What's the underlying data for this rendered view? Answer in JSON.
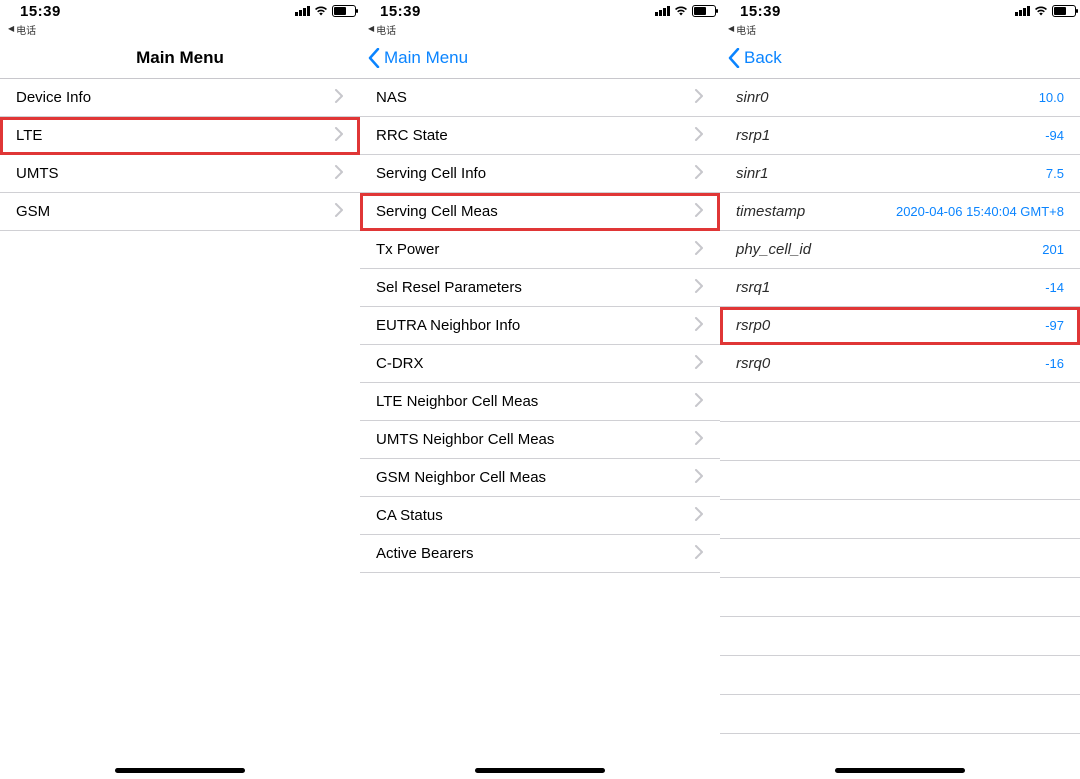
{
  "status": {
    "time": "15:39",
    "breadcrumb_arrow": "◀",
    "breadcrumb_label": "电话"
  },
  "phone1": {
    "title": "Main Menu",
    "items": [
      {
        "label": "Device Info",
        "highlight": false
      },
      {
        "label": "LTE",
        "highlight": true
      },
      {
        "label": "UMTS",
        "highlight": false
      },
      {
        "label": "GSM",
        "highlight": false
      }
    ]
  },
  "phone2": {
    "back_label": "Main Menu",
    "items": [
      {
        "label": "NAS",
        "highlight": false
      },
      {
        "label": "RRC State",
        "highlight": false
      },
      {
        "label": "Serving Cell Info",
        "highlight": false
      },
      {
        "label": "Serving Cell Meas",
        "highlight": true
      },
      {
        "label": "Tx Power",
        "highlight": false
      },
      {
        "label": "Sel Resel Parameters",
        "highlight": false
      },
      {
        "label": "EUTRA Neighbor Info",
        "highlight": false
      },
      {
        "label": "C-DRX",
        "highlight": false
      },
      {
        "label": "LTE Neighbor Cell Meas",
        "highlight": false
      },
      {
        "label": "UMTS Neighbor Cell Meas",
        "highlight": false
      },
      {
        "label": "GSM Neighbor Cell Meas",
        "highlight": false
      },
      {
        "label": "CA Status",
        "highlight": false
      },
      {
        "label": "Active Bearers",
        "highlight": false
      }
    ]
  },
  "phone3": {
    "back_label": "Back",
    "items": [
      {
        "label": "sinr0",
        "value": "10.0",
        "highlight": false
      },
      {
        "label": "rsrp1",
        "value": "-94",
        "highlight": false
      },
      {
        "label": "sinr1",
        "value": "7.5",
        "highlight": false
      },
      {
        "label": "timestamp",
        "value": "2020-04-06 15:40:04 GMT+8",
        "highlight": false
      },
      {
        "label": "phy_cell_id",
        "value": "201",
        "highlight": false
      },
      {
        "label": "rsrq1",
        "value": "-14",
        "highlight": false
      },
      {
        "label": "rsrp0",
        "value": "-97",
        "highlight": true
      },
      {
        "label": "rsrq0",
        "value": "-16",
        "highlight": false
      }
    ],
    "empty_rows_below": 9
  }
}
